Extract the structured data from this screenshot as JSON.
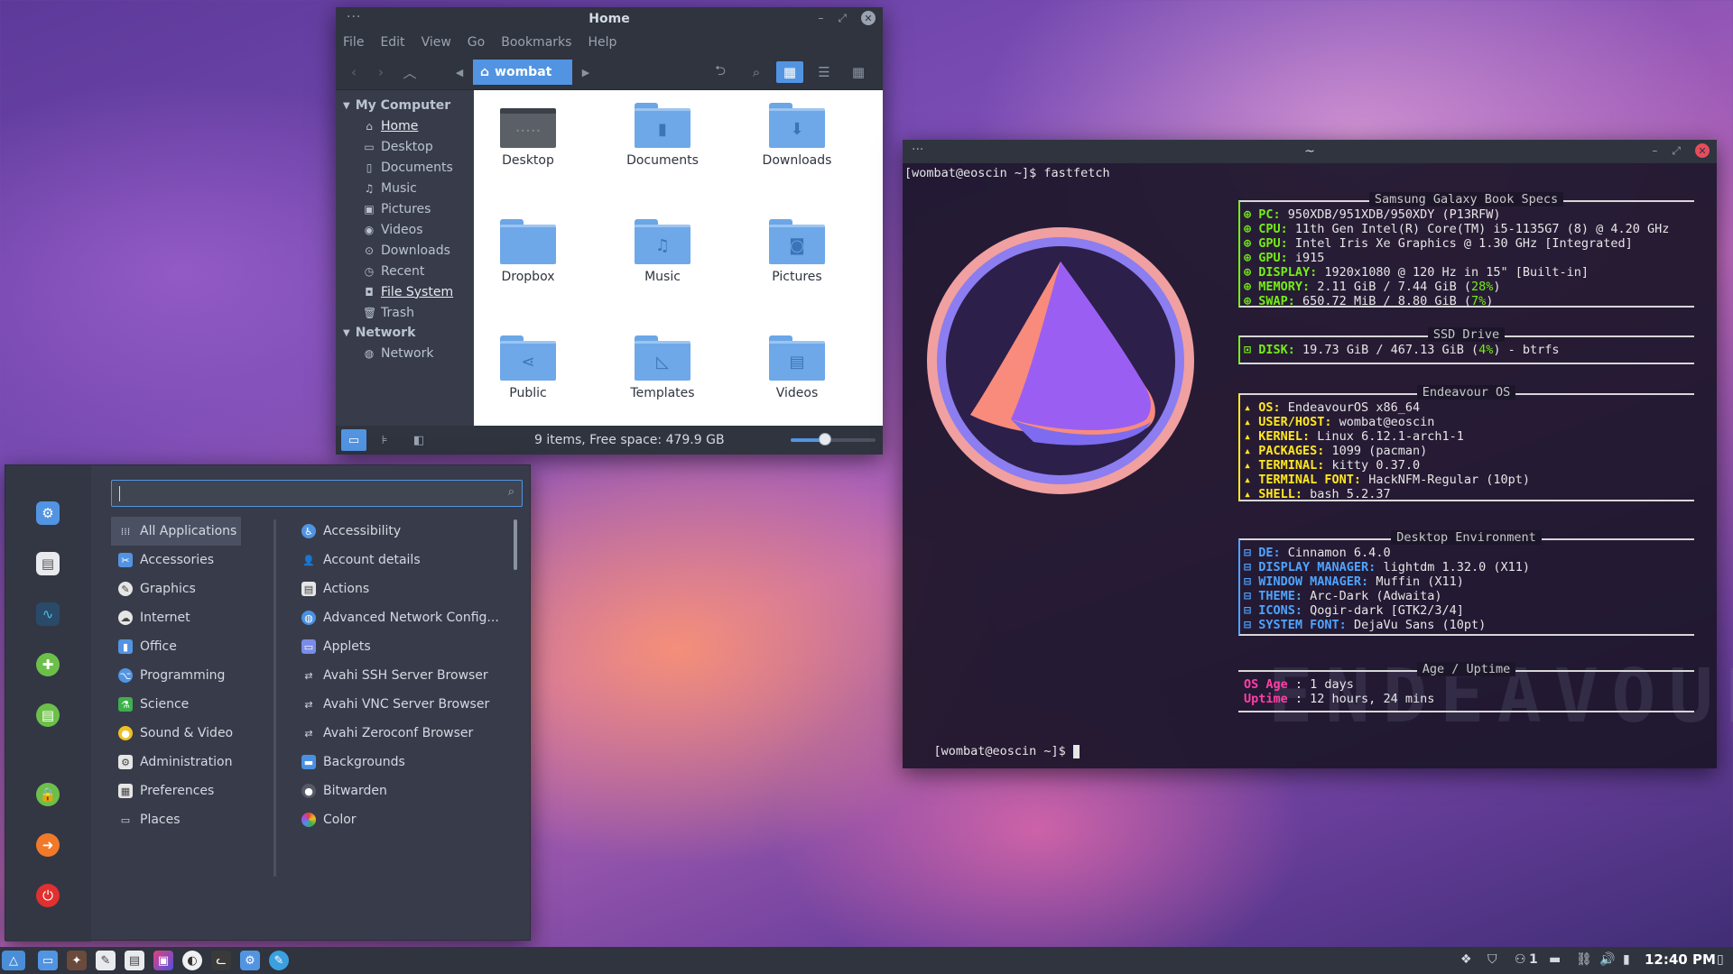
{
  "file_manager": {
    "title": "Home",
    "menu": [
      "File",
      "Edit",
      "View",
      "Go",
      "Bookmarks",
      "Help"
    ],
    "path": "wombat",
    "sidebar": {
      "my_computer": "My Computer",
      "items": [
        "Home",
        "Desktop",
        "Documents",
        "Music",
        "Pictures",
        "Videos",
        "Downloads",
        "Recent",
        "File System",
        "Trash"
      ],
      "network_header": "Network",
      "network_items": [
        "Network"
      ]
    },
    "files": [
      "Desktop",
      "Documents",
      "Downloads",
      "Dropbox",
      "Music",
      "Pictures",
      "Public",
      "Templates",
      "Videos"
    ],
    "status": "9 items, Free space: 479.9 GB",
    "zoom_level": 0.4
  },
  "terminal": {
    "title": "~",
    "prompt1": "[wombat@eoscin ~]$ fastfetch",
    "prompt2": "[wombat@eoscin ~]$ ",
    "watermark": "ENDEAVOUROS",
    "sections": {
      "specs": {
        "header": "Samsung Galaxy Book Specs",
        "lines": [
          {
            "k": "PC",
            "v": "950XDB/951XDB/950XDY (P13RFW)"
          },
          {
            "k": "CPU",
            "v": "11th Gen Intel(R) Core(TM) i5-1135G7 (8) @ 4.20 GHz"
          },
          {
            "k": "GPU",
            "v": "Intel Iris Xe Graphics @ 1.30 GHz [Integrated]"
          },
          {
            "k": "GPU",
            "v": "i915"
          },
          {
            "k": "DISPLAY",
            "v": "1920x1080 @ 120 Hz in 15\" [Built-in]"
          },
          {
            "k": "MEMORY",
            "v": "2.11 GiB / 7.44 GiB (",
            "p": "28%",
            "e": ")"
          },
          {
            "k": "SWAP",
            "v": "650.72 MiB / 8.80 GiB (",
            "p": "7%",
            "e": ")"
          }
        ]
      },
      "ssd": {
        "header": "SSD Drive",
        "lines": [
          {
            "k": "DISK",
            "v": "19.73 GiB / 467.13 GiB (",
            "p": "4%",
            "e": ") - btrfs"
          }
        ]
      },
      "os": {
        "header": "Endeavour OS",
        "lines": [
          {
            "k": "OS",
            "v": "EndeavourOS x86_64"
          },
          {
            "k": "USER/HOST",
            "v": "wombat@eoscin"
          },
          {
            "k": "KERNEL",
            "v": "Linux 6.12.1-arch1-1"
          },
          {
            "k": "PACKAGES",
            "v": "1099 (pacman)"
          },
          {
            "k": "TERMINAL",
            "v": "kitty 0.37.0"
          },
          {
            "k": "TERMINAL FONT",
            "v": "HackNFM-Regular (10pt)"
          },
          {
            "k": "SHELL",
            "v": "bash 5.2.37"
          }
        ]
      },
      "de": {
        "header": "Desktop Environment",
        "lines": [
          {
            "k": "DE",
            "v": "Cinnamon 6.4.0"
          },
          {
            "k": "DISPLAY MANAGER",
            "v": "lightdm 1.32.0 (X11)"
          },
          {
            "k": "WINDOW MANAGER",
            "v": "Muffin (X11)"
          },
          {
            "k": "THEME",
            "v": "Arc-Dark (Adwaita)"
          },
          {
            "k": "ICONS",
            "v": "Qogir-dark [GTK2/3/4]"
          },
          {
            "k": "SYSTEM FONT",
            "v": "DejaVu Sans (10pt)"
          }
        ]
      },
      "age": {
        "header": "Age / Uptime",
        "lines": [
          {
            "k": "OS Age ",
            "v": ": 1 days"
          },
          {
            "k": "Uptime ",
            "v": ": 12 hours, 24 mins"
          }
        ]
      }
    }
  },
  "app_menu": {
    "search_value": "",
    "categories": [
      "All Applications",
      "Accessories",
      "Graphics",
      "Internet",
      "Office",
      "Programming",
      "Science",
      "Sound & Video",
      "Administration",
      "Preferences",
      "Places"
    ],
    "apps": [
      "Accessibility",
      "Account details",
      "Actions",
      "Advanced Network Config...",
      "Applets",
      "Avahi SSH Server Browser",
      "Avahi VNC Server Browser",
      "Avahi Zeroconf Browser",
      "Backgrounds",
      "Bitwarden",
      "Color"
    ]
  },
  "taskbar": {
    "clock": "12:40 PM",
    "workspace": "1"
  },
  "colors": {
    "accent": "#5294e2",
    "panel": "#2f343f",
    "window": "#383c4a",
    "term_green": "#74ee15",
    "term_yellow": "#ffe81f",
    "term_blue": "#4ea4ff",
    "term_pink": "#ff3ea5"
  }
}
